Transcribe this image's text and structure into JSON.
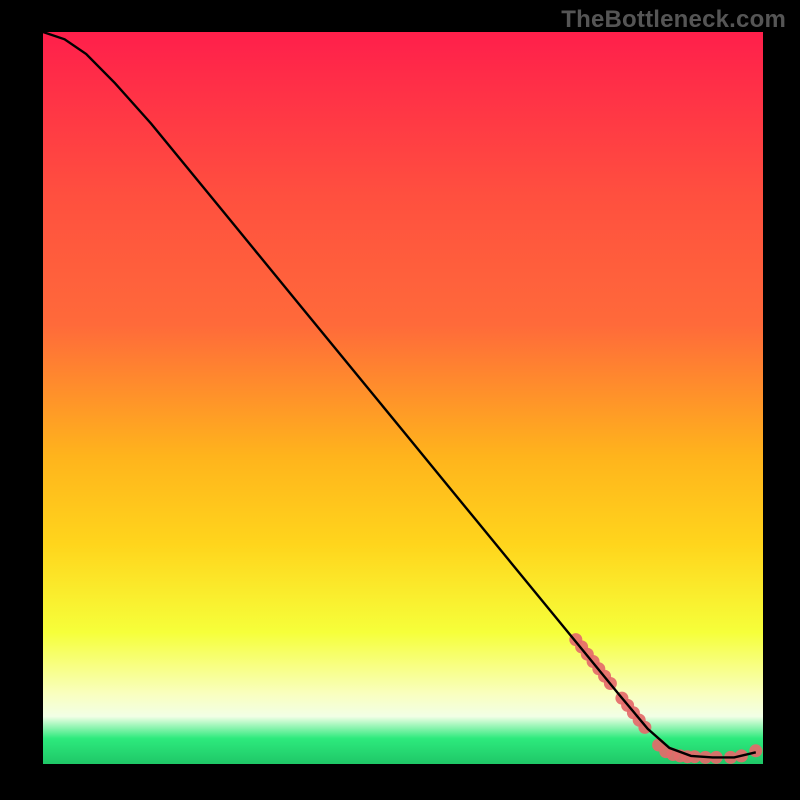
{
  "watermark": "TheBottleneck.com",
  "colors": {
    "gradient_top": "#ff1f4b",
    "gradient_mid_upper": "#ff6a3a",
    "gradient_mid": "#ffd51c",
    "gradient_mid_lower": "#f6ff3a",
    "gradient_band": "#f2ffe6",
    "gradient_green": "#2dea7d",
    "curve": "#000000",
    "markers": "#e46a6a",
    "frame": "#000000"
  },
  "chart_data": {
    "type": "line",
    "title": "",
    "xlabel": "",
    "ylabel": "",
    "xlim": [
      0,
      100
    ],
    "ylim": [
      0,
      100
    ],
    "series": [
      {
        "name": "bottleneck-curve",
        "x": [
          0,
          3,
          6,
          10,
          15,
          20,
          25,
          30,
          35,
          40,
          45,
          50,
          55,
          60,
          65,
          70,
          75,
          80,
          84,
          87,
          90,
          93,
          96,
          99
        ],
        "y": [
          100,
          99,
          97,
          93,
          87.5,
          81.5,
          75.5,
          69.5,
          63.5,
          57.5,
          51.5,
          45.5,
          39.5,
          33.5,
          27.5,
          21.5,
          15.5,
          9.5,
          4.8,
          2.2,
          1.1,
          0.9,
          0.9,
          1.6
        ]
      }
    ],
    "marker_clusters": [
      {
        "name": "cluster-upper",
        "points": [
          {
            "x": 74.0,
            "y": 17.0
          },
          {
            "x": 74.8,
            "y": 16.0
          },
          {
            "x": 75.6,
            "y": 15.0
          },
          {
            "x": 76.4,
            "y": 14.0
          },
          {
            "x": 77.2,
            "y": 13.0
          },
          {
            "x": 78.0,
            "y": 12.0
          },
          {
            "x": 78.8,
            "y": 11.0
          }
        ]
      },
      {
        "name": "cluster-mid",
        "points": [
          {
            "x": 80.4,
            "y": 9.0
          },
          {
            "x": 81.2,
            "y": 8.0
          },
          {
            "x": 82.0,
            "y": 7.0
          },
          {
            "x": 82.8,
            "y": 6.0
          },
          {
            "x": 83.6,
            "y": 5.0
          }
        ]
      },
      {
        "name": "floor-points",
        "points": [
          {
            "x": 85.5,
            "y": 2.6
          },
          {
            "x": 86.5,
            "y": 1.7
          },
          {
            "x": 87.5,
            "y": 1.3
          },
          {
            "x": 88.5,
            "y": 1.1
          },
          {
            "x": 89.5,
            "y": 1.0
          },
          {
            "x": 90.5,
            "y": 1.0
          },
          {
            "x": 92.0,
            "y": 0.9
          },
          {
            "x": 93.5,
            "y": 0.9
          },
          {
            "x": 95.5,
            "y": 0.9
          },
          {
            "x": 97.0,
            "y": 1.1
          },
          {
            "x": 99.0,
            "y": 1.8
          }
        ]
      }
    ]
  }
}
